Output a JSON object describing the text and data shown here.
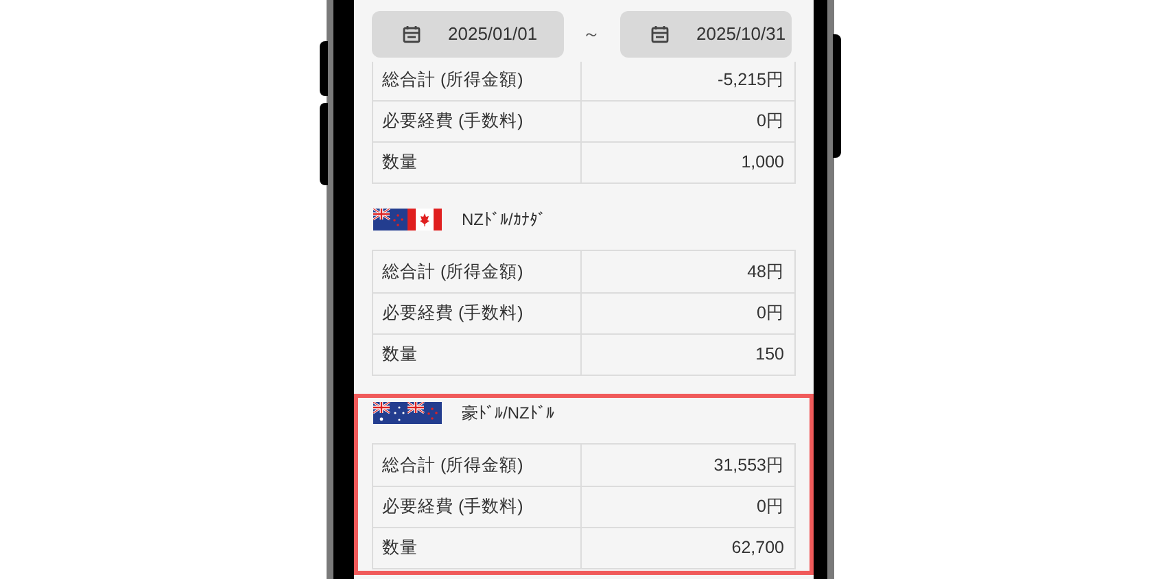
{
  "date_range": {
    "start": "2025/01/01",
    "separator": "～",
    "end": "2025/10/31"
  },
  "sections": [
    {
      "highlighted": false,
      "rows": [
        {
          "label": "総合計 (所得金額)",
          "value": "-5,215円"
        },
        {
          "label": "必要経費 (手数料)",
          "value": "0円"
        },
        {
          "label": "数量",
          "value": "1,000"
        }
      ]
    },
    {
      "pair": "NZﾄﾞﾙ/ｶﾅﾀﾞ",
      "highlighted": false,
      "flags": [
        {
          "kind": "nz"
        },
        {
          "kind": "ca"
        }
      ],
      "rows": [
        {
          "label": "総合計 (所得金額)",
          "value": "48円"
        },
        {
          "label": "必要経費 (手数料)",
          "value": "0円"
        },
        {
          "label": "数量",
          "value": "150"
        }
      ]
    },
    {
      "pair": "豪ﾄﾞﾙ/NZﾄﾞﾙ",
      "highlighted": true,
      "flags": [
        {
          "kind": "au"
        },
        {
          "kind": "nz"
        }
      ],
      "rows": [
        {
          "label": "総合計 (所得金額)",
          "value": "31,553円"
        },
        {
          "label": "必要経費 (手数料)",
          "value": "0円"
        },
        {
          "label": "数量",
          "value": "62,700"
        }
      ]
    }
  ]
}
